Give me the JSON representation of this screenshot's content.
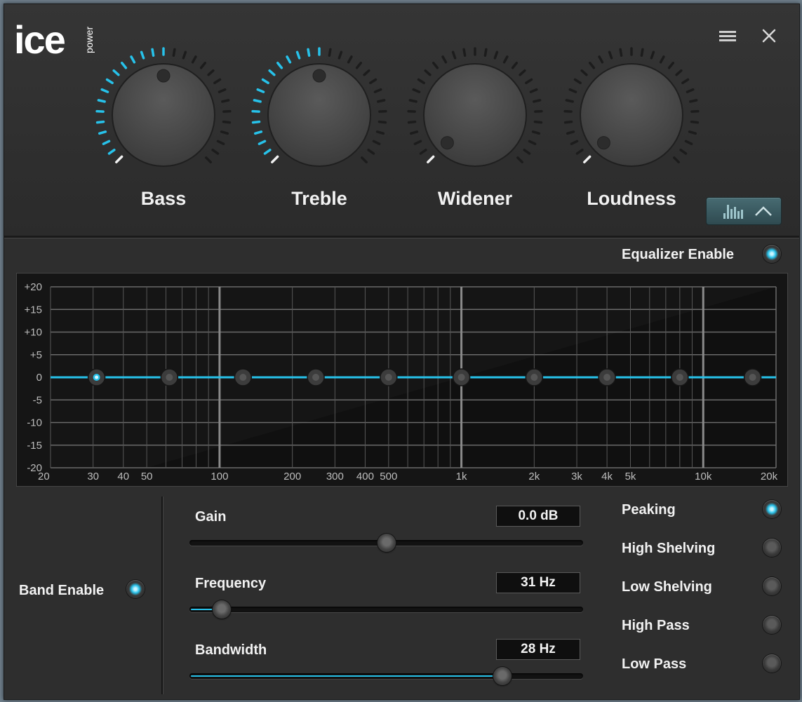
{
  "brand": {
    "logo_main": "ice",
    "logo_sub": "power"
  },
  "window_controls": {
    "menu_icon": "hamburger-menu-icon",
    "close_icon": "close-icon"
  },
  "knobs": [
    {
      "id": "bass",
      "label": "Bass",
      "level": 0.5
    },
    {
      "id": "treble",
      "label": "Treble",
      "level": 0.5
    },
    {
      "id": "widener",
      "label": "Widener",
      "level": 0
    },
    {
      "id": "loudness",
      "label": "Loudness",
      "level": 0
    }
  ],
  "eq_toggle": {
    "icon": "equalizer-bars-icon",
    "chevron": "chevron-up-icon"
  },
  "equalizer": {
    "enable_label": "Equalizer Enable",
    "enabled": true,
    "y_ticks": [
      "+20",
      "+15",
      "+10",
      "+5",
      "0",
      "-5",
      "-10",
      "-15",
      "-20"
    ],
    "x_ticks": [
      "20",
      "30",
      "40",
      "50",
      "100",
      "200",
      "300",
      "400",
      "500",
      "1k",
      "2k",
      "3k",
      "4k",
      "5k",
      "10k",
      "20k"
    ],
    "band_frequencies_hz": [
      31,
      62,
      125,
      250,
      500,
      1000,
      2000,
      4000,
      8000,
      16000
    ],
    "band_gains_db": [
      0,
      0,
      0,
      0,
      0,
      0,
      0,
      0,
      0,
      0
    ],
    "selected_band_index": 0
  },
  "band": {
    "enable_label": "Band Enable",
    "enabled": true,
    "gain": {
      "label": "Gain",
      "value": "0.0 dB",
      "level": 0.5
    },
    "frequency": {
      "label": "Frequency",
      "value": "31 Hz",
      "level": 0.06
    },
    "bandwidth": {
      "label": "Bandwidth",
      "value": "28 Hz",
      "level": 0.81
    }
  },
  "filter_types": [
    {
      "label": "Peaking",
      "selected": true
    },
    {
      "label": "High Shelving",
      "selected": false
    },
    {
      "label": "Low Shelving",
      "selected": false
    },
    {
      "label": "High Pass",
      "selected": false
    },
    {
      "label": "Low Pass",
      "selected": false
    }
  ],
  "colors": {
    "accent": "#27c2ea",
    "panel": "#2e2e2e",
    "text": "#f2f2f2"
  }
}
